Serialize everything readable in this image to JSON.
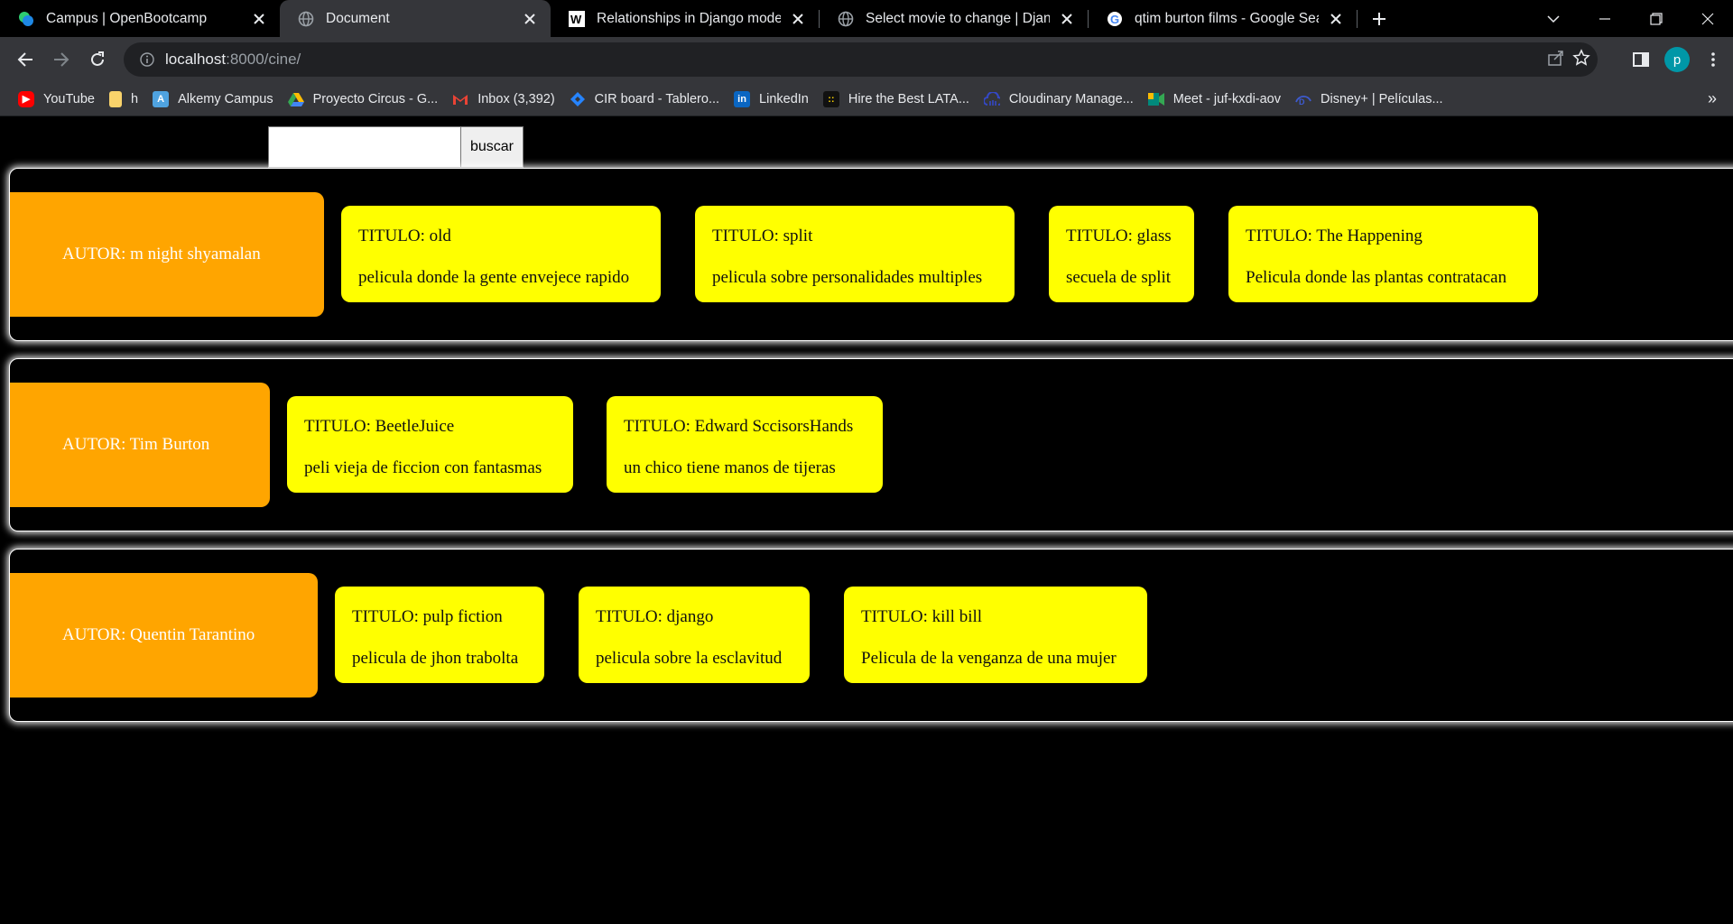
{
  "browser": {
    "tabs": [
      {
        "title": "Campus | OpenBootcamp",
        "icon": "openbootcamp-icon",
        "active": false
      },
      {
        "title": "Document",
        "icon": "globe-icon",
        "active": true
      },
      {
        "title": "Relationships in Django models",
        "icon": "w-icon",
        "active": false
      },
      {
        "title": "Select movie to change | Django",
        "icon": "globe-icon",
        "active": false
      },
      {
        "title": "qtim burton films - Google Searc",
        "icon": "google-icon",
        "active": false
      }
    ],
    "address": {
      "host": "localhost",
      "path": ":8000/cine/"
    },
    "profile_initial": "p",
    "bookmarks": [
      {
        "label": "YouTube",
        "icon": "youtube-icon",
        "color": "#ff0000"
      },
      {
        "label": "h",
        "icon": "folder-icon",
        "color": "#f9d36b"
      },
      {
        "label": "Alkemy Campus",
        "icon": "alkemy-icon",
        "color": "#4fa3e0"
      },
      {
        "label": "Proyecto Circus - G...",
        "icon": "drive-icon",
        "color": "#34a853"
      },
      {
        "label": "Inbox (3,392)",
        "icon": "gmail-icon",
        "color": "#ea4335"
      },
      {
        "label": "CIR board - Tablero...",
        "icon": "jira-icon",
        "color": "#2684ff"
      },
      {
        "label": "LinkedIn",
        "icon": "linkedin-icon",
        "color": "#0a66c2"
      },
      {
        "label": "Hire the Best LATA...",
        "icon": "hire-icon",
        "color": "#111111"
      },
      {
        "label": "Cloudinary Manage...",
        "icon": "cloudinary-icon",
        "color": "#3448c5"
      },
      {
        "label": "Meet - juf-kxdi-aov",
        "icon": "meet-icon",
        "color": "#00897b"
      },
      {
        "label": "Disney+ | Películas...",
        "icon": "disney-icon",
        "color": "#1a3fa0"
      }
    ],
    "overflow": "»"
  },
  "search": {
    "button_label": "buscar",
    "value": ""
  },
  "authors": [
    {
      "label": "AUTOR: m night shyamalan",
      "movies": [
        {
          "title": "TITULO: old",
          "desc": "pelicula donde la gente envejece rapido"
        },
        {
          "title": "TITULO: split",
          "desc": "pelicula sobre personalidades multiples"
        },
        {
          "title": "TITULO: glass",
          "desc": "secuela de split"
        },
        {
          "title": "TITULO: The Happening",
          "desc": "Pelicula donde las plantas contratacan"
        }
      ]
    },
    {
      "label": "AUTOR: Tim Burton",
      "movies": [
        {
          "title": "TITULO: BeetleJuice",
          "desc": "peli vieja de ficcion con fantasmas"
        },
        {
          "title": "TITULO: Edward SccisorsHands",
          "desc": "un chico tiene manos de tijeras"
        }
      ]
    },
    {
      "label": "AUTOR: Quentin Tarantino",
      "movies": [
        {
          "title": "TITULO: pulp fiction",
          "desc": "pelicula de jhon trabolta"
        },
        {
          "title": "TITULO: django",
          "desc": "pelicula sobre la esclavitud"
        },
        {
          "title": "TITULO: kill bill",
          "desc": "Pelicula de la venganza de una mujer"
        }
      ]
    }
  ],
  "colors": {
    "author_bg": "#ffa500",
    "card_bg": "#ffff00",
    "page_bg": "#000000"
  }
}
